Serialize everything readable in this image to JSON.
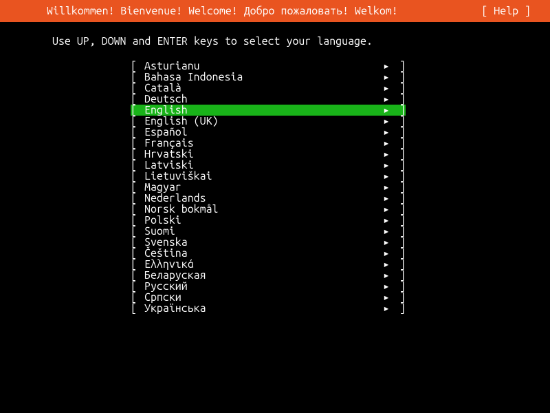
{
  "header": {
    "title": "Willkommen! Bienvenue! Welcome! Добро пожаловать! Welkom!",
    "help": "[ Help ]"
  },
  "instructions": "Use UP, DOWN and ENTER keys to select your language.",
  "selected_index": 4,
  "languages": [
    "Asturianu",
    "Bahasa Indonesia",
    "Català",
    "Deutsch",
    "English",
    "English (UK)",
    "Español",
    "Français",
    "Hrvatski",
    "Latviski",
    "Lietuviškai",
    "Magyar",
    "Nederlands",
    "Norsk bokmål",
    "Polski",
    "Suomi",
    "Svenska",
    "Čeština",
    "Ελληνικά",
    "Беларуская",
    "Русский",
    "Српски",
    "Українська"
  ],
  "brackets": {
    "left": "[ ",
    "right": " ]",
    "arrow": "▸"
  }
}
